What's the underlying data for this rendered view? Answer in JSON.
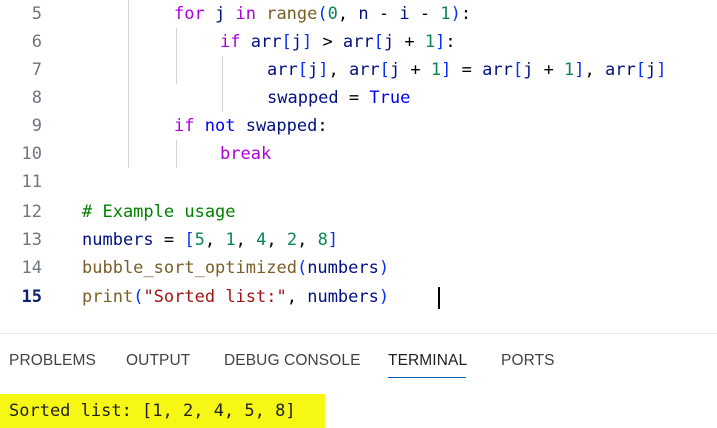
{
  "editor": {
    "line_numbers": [
      "5",
      "6",
      "7",
      "8",
      "9",
      "10",
      "11",
      "12",
      "13",
      "14",
      "15"
    ],
    "active_line": "15",
    "lines": {
      "l5": {
        "for_kw": "for",
        "j": "j",
        "in_kw": "in",
        "range_fn": "range",
        "open": "(",
        "zero": "0",
        "sep1": ", ",
        "n": "n",
        "minus1": " - ",
        "i": "i",
        "minus2": " - ",
        "one": "1",
        "close": ")",
        "colon": ":"
      },
      "l6": {
        "if_kw": "if",
        "arr1": "arr",
        "b1o": "[",
        "j1": "j",
        "b1c": "]",
        "gt": " > ",
        "arr2": "arr",
        "b2o": "[",
        "j2": "j",
        "plus": " + ",
        "one": "1",
        "b2c": "]",
        "colon": ":"
      },
      "l7": {
        "arr1": "arr",
        "b1o": "[",
        "j1": "j",
        "b1c": "]",
        "comma1": ", ",
        "arr2": "arr",
        "b2o": "[",
        "j2": "j",
        "plus1": " + ",
        "one1": "1",
        "b2c": "]",
        "eq": " = ",
        "arr3": "arr",
        "b3o": "[",
        "j3": "j",
        "plus2": " + ",
        "one2": "1",
        "b3c": "]",
        "comma2": ", ",
        "arr4": "arr",
        "b4o": "[",
        "j4": "j",
        "b4c": "]"
      },
      "l8": {
        "swapped": "swapped",
        "eq": " = ",
        "true_kw": "True"
      },
      "l9": {
        "if_kw": "if",
        "not_kw": "not",
        "swapped": "swapped",
        "colon": ":"
      },
      "l10": {
        "break_kw": "break"
      },
      "l12": {
        "comment": "# Example usage"
      },
      "l13": {
        "numbers": "numbers",
        "eq": " = ",
        "open": "[",
        "n5": "5",
        "c1": ", ",
        "n1": "1",
        "c2": ", ",
        "n4": "4",
        "c3": ", ",
        "n2": "2",
        "c4": ", ",
        "n8": "8",
        "close": "]"
      },
      "l14": {
        "fn": "bubble_sort_optimized",
        "open": "(",
        "numbers": "numbers",
        "close": ")"
      },
      "l15": {
        "fn": "print",
        "open": "(",
        "str": "\"Sorted list:\"",
        "comma": ", ",
        "numbers": "numbers",
        "close": ")"
      }
    }
  },
  "panel": {
    "tabs": [
      "PROBLEMS",
      "OUTPUT",
      "DEBUG CONSOLE",
      "TERMINAL",
      "PORTS"
    ],
    "active_tab": "TERMINAL",
    "terminal_output": "Sorted list: [1, 2, 4, 5, 8]",
    "highlight_color": "#f7f715"
  },
  "colors": {
    "keyword": "#af00db",
    "builtin": "#0000ff",
    "function": "#795e26",
    "variable": "#001080",
    "number": "#098658",
    "string": "#a31515",
    "comment": "#008000"
  }
}
